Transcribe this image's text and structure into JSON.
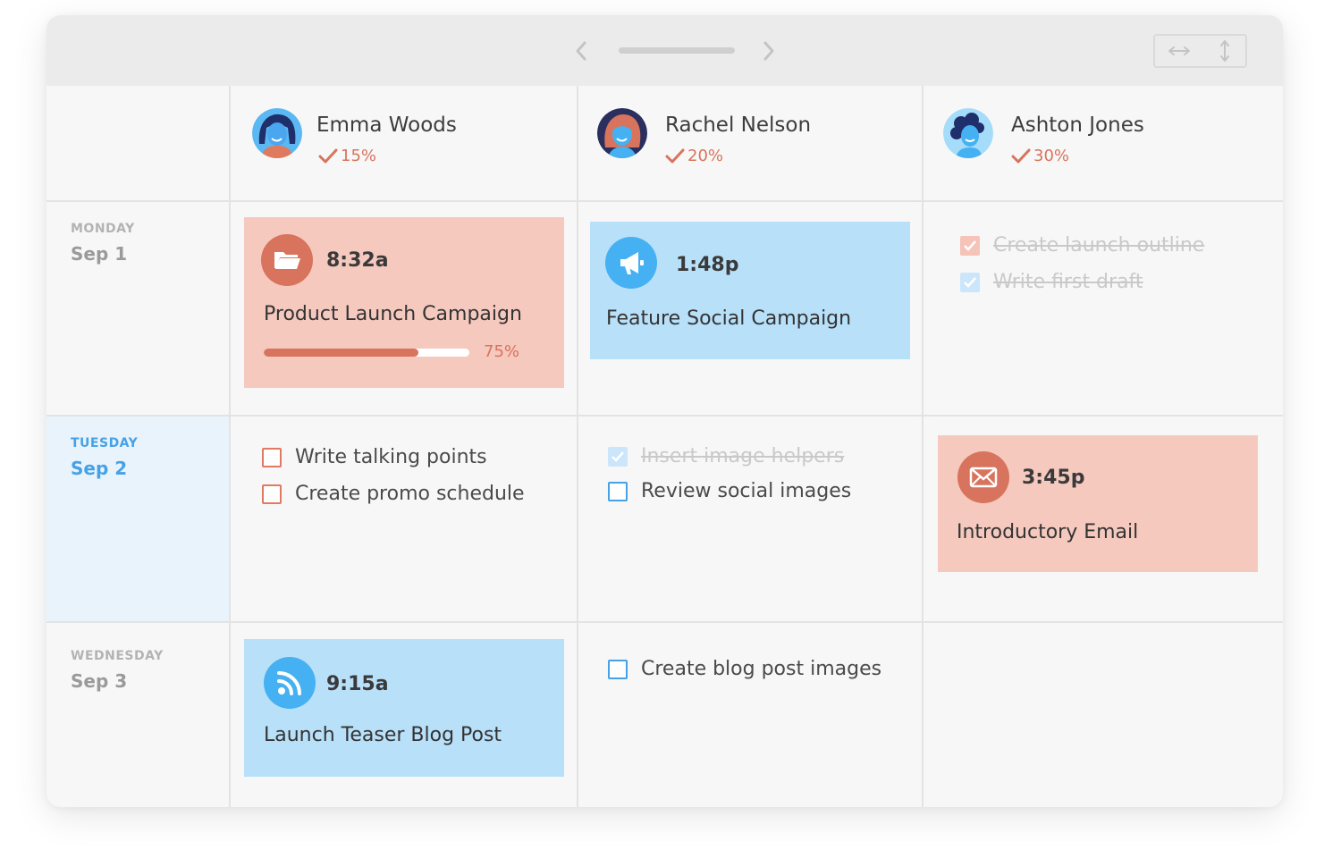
{
  "team": [
    {
      "name": "Emma Woods",
      "progress": "15%"
    },
    {
      "name": "Rachel Nelson",
      "progress": "20%"
    },
    {
      "name": "Ashton Jones",
      "progress": "30%"
    }
  ],
  "days": [
    {
      "name": "MONDAY",
      "date": "Sep 1",
      "active": false
    },
    {
      "name": "TUESDAY",
      "date": "Sep 2",
      "active": true
    },
    {
      "name": "WEDNESDAY",
      "date": "Sep 3",
      "active": false
    }
  ],
  "cards": {
    "mon_emma": {
      "icon": "folder-icon",
      "time": "8:32a",
      "title": "Product Launch Campaign",
      "progress": 0.75,
      "progress_label": "75%",
      "color": "#f6c9bf"
    },
    "mon_rachel": {
      "icon": "megaphone-icon",
      "time": "1:48p",
      "title": "Feature Social Campaign",
      "color": "#b8e0f9"
    },
    "tue_ashton": {
      "icon": "envelope-icon",
      "time": "3:45p",
      "title": "Introductory Email",
      "color": "#f6c9bf"
    },
    "wed_emma": {
      "icon": "rss-icon",
      "time": "9:15a",
      "title": "Launch Teaser Blog Post",
      "color": "#b8e0f9"
    }
  },
  "tasks": {
    "mon_ashton": [
      {
        "text": "Create launch outline",
        "done": true
      },
      {
        "text": "Write first draft",
        "done": true
      }
    ],
    "tue_emma": [
      {
        "text": "Write talking points",
        "done": false
      },
      {
        "text": "Create promo schedule",
        "done": false
      }
    ],
    "tue_rachel": [
      {
        "text": "Insert image helpers",
        "done": true
      },
      {
        "text": "Review social images",
        "done": false
      }
    ],
    "wed_rachel": [
      {
        "text": "Create blog post images",
        "done": false
      }
    ]
  },
  "colors": {
    "accent_red": "#d8735d",
    "accent_blue": "#46b1f2",
    "active_day": "#46a2e6"
  }
}
